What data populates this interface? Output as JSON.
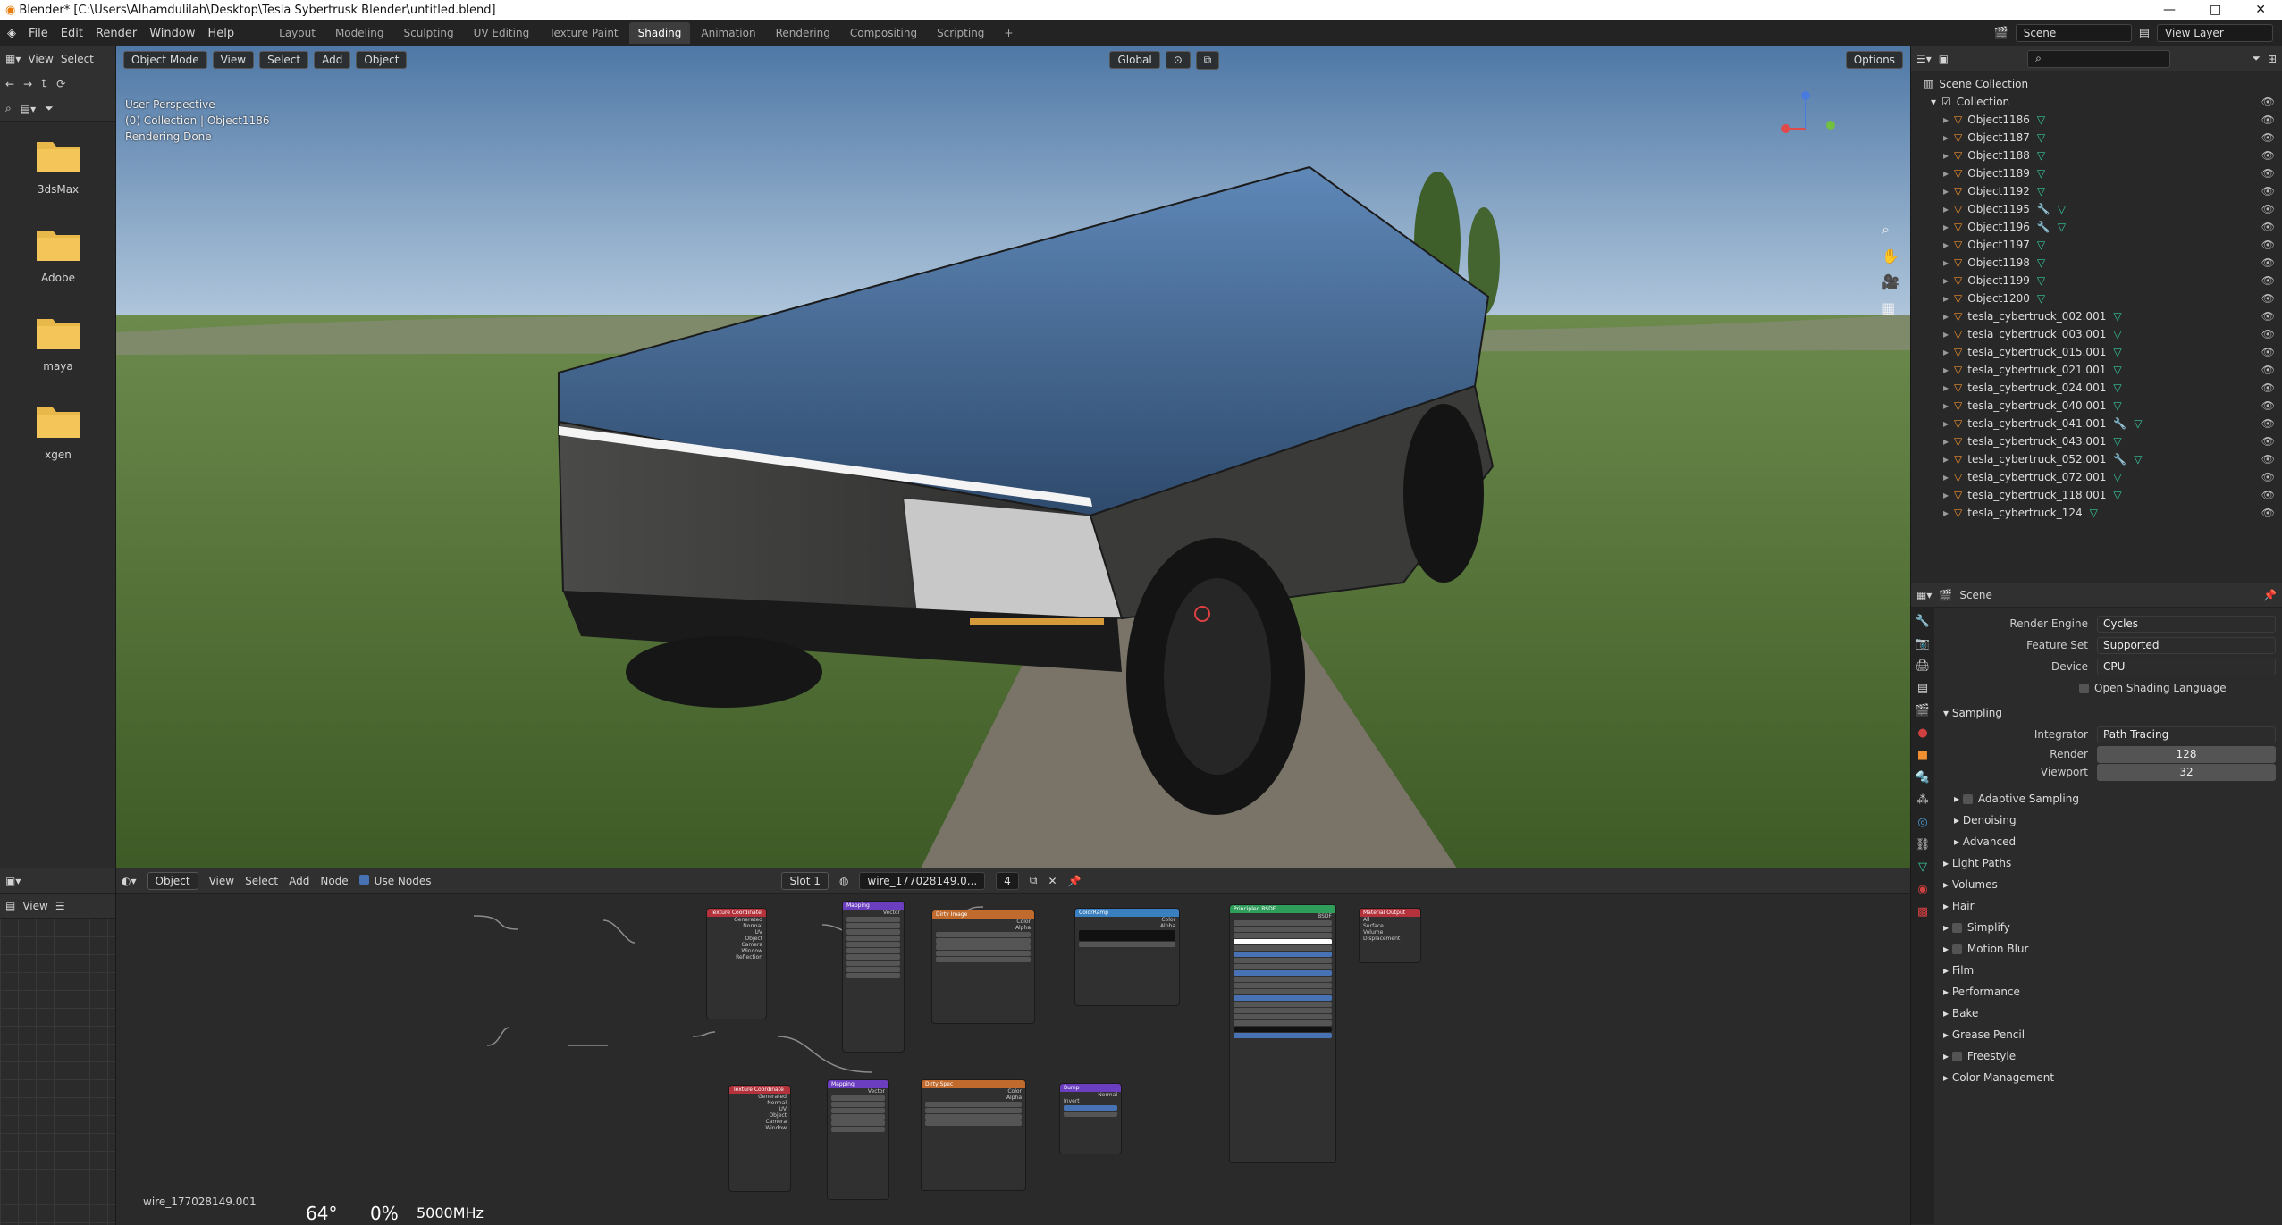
{
  "titlebar": {
    "title": "Blender* [C:\\Users\\Alhamdulilah\\Desktop\\Tesla Sybertrusk Blender\\untitled.blend]",
    "minimize": "—",
    "maximize": "□",
    "close": "✕"
  },
  "menus": [
    "File",
    "Edit",
    "Render",
    "Window",
    "Help"
  ],
  "workspaces": [
    "Layout",
    "Modeling",
    "Sculpting",
    "UV Editing",
    "Texture Paint",
    "Shading",
    "Animation",
    "Rendering",
    "Compositing",
    "Scripting"
  ],
  "active_workspace": "Shading",
  "scene": {
    "name": "Scene",
    "view_layer": "View Layer"
  },
  "file_browser": {
    "header": [
      "View",
      "Select"
    ],
    "folders": [
      "3dsMax",
      "Adobe",
      "maya",
      "xgen"
    ]
  },
  "viewport": {
    "mode": "Object Mode",
    "menus": [
      "View",
      "Select",
      "Add",
      "Object"
    ],
    "orientation": "Global",
    "options_label": "Options",
    "info": [
      "User Perspective",
      "(0) Collection | Object1186",
      "Rendering Done"
    ]
  },
  "node_editor": {
    "object_label": "Object",
    "menus": [
      "View",
      "Select",
      "Add",
      "Node"
    ],
    "use_nodes": "Use Nodes",
    "slot": "Slot 1",
    "material": "wire_177028149.0...",
    "material_users": "4",
    "sidebar_label": "View",
    "footer_material": "wire_177028149.001",
    "footer_stats": [
      "64°",
      "0%",
      "5000MHz"
    ]
  },
  "outliner": {
    "root": "Scene Collection",
    "collection": "Collection",
    "items": [
      "Object1186",
      "Object1187",
      "Object1188",
      "Object1189",
      "Object1192",
      "Object1195",
      "Object1196",
      "Object1197",
      "Object1198",
      "Object1199",
      "Object1200",
      "tesla_cybertruck_002.001",
      "tesla_cybertruck_003.001",
      "tesla_cybertruck_015.001",
      "tesla_cybertruck_021.001",
      "tesla_cybertruck_024.001",
      "tesla_cybertruck_040.001",
      "tesla_cybertruck_041.001",
      "tesla_cybertruck_043.001",
      "tesla_cybertruck_052.001",
      "tesla_cybertruck_072.001",
      "tesla_cybertruck_118.001",
      "tesla_cybertruck_124"
    ]
  },
  "properties": {
    "context": "Scene",
    "render_engine_label": "Render Engine",
    "render_engine": "Cycles",
    "feature_set_label": "Feature Set",
    "feature_set": "Supported",
    "device_label": "Device",
    "device": "CPU",
    "osl": "Open Shading Language",
    "sampling": "Sampling",
    "integrator_label": "Integrator",
    "integrator": "Path Tracing",
    "render_label": "Render",
    "render_samples": "128",
    "viewport_label": "Viewport",
    "viewport_samples": "32",
    "subsections": [
      "Adaptive Sampling",
      "Denoising",
      "Advanced"
    ],
    "panels": [
      "Light Paths",
      "Volumes",
      "Hair",
      "Simplify",
      "Motion Blur",
      "Film",
      "Performance",
      "Bake",
      "Grease Pencil",
      "Freestyle",
      "Color Management"
    ]
  },
  "colors": {
    "accent": "#4772b3",
    "folder": "#e8b84a",
    "outliner_mesh": "#f09030",
    "vertex_group": "#35c8a0"
  }
}
